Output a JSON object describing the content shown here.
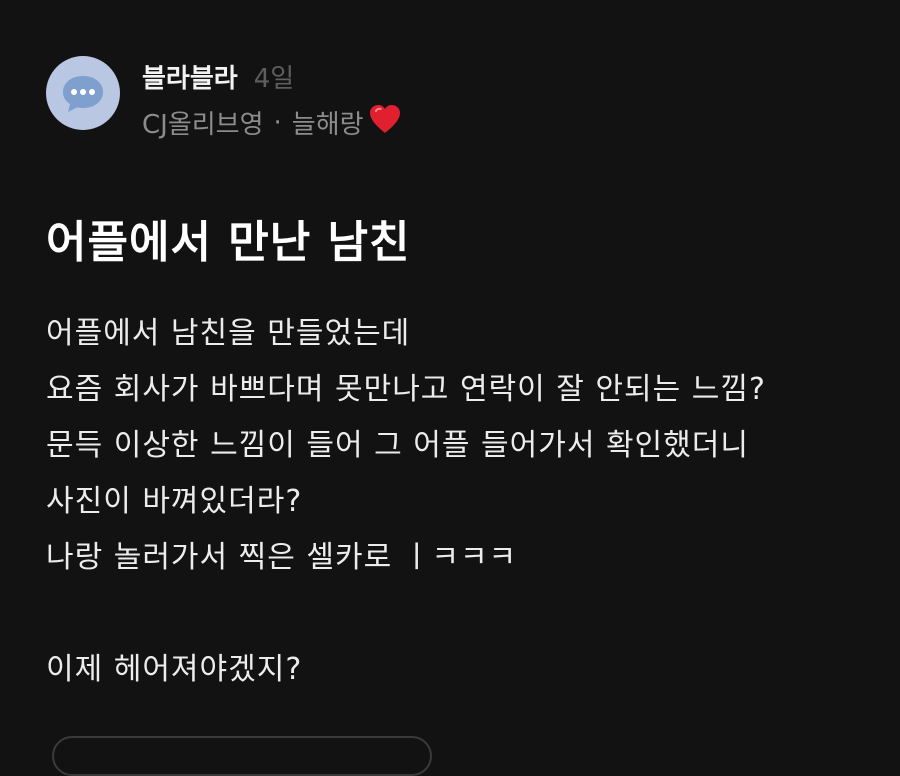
{
  "post": {
    "author": "블라블라",
    "time": "4일",
    "company": "CJ올리브영",
    "separator": "·",
    "nickname": "늘해랑",
    "title": "어플에서 만난 남친",
    "body_lines": [
      "어플에서 남친을 만들었는데",
      "요즘 회사가 바쁘다며 못만나고 연락이 잘 안되는 느낌?",
      "문득 이상한 느낌이 들어 그 어플 들어가서 확인했더니",
      "사진이 바껴있더라?",
      "나랑 놀러가서 찍은 셀카로 ㅣㅋㅋㅋ",
      "",
      "이제 헤어져야겠지?"
    ]
  },
  "icons": {
    "avatar": "chat-bubble-icon",
    "badge": "red-heart-icon"
  },
  "colors": {
    "background": "#121212",
    "avatar_bg": "#b9c7e2",
    "heart": "#e0202f",
    "muted": "#8c8c8c"
  }
}
